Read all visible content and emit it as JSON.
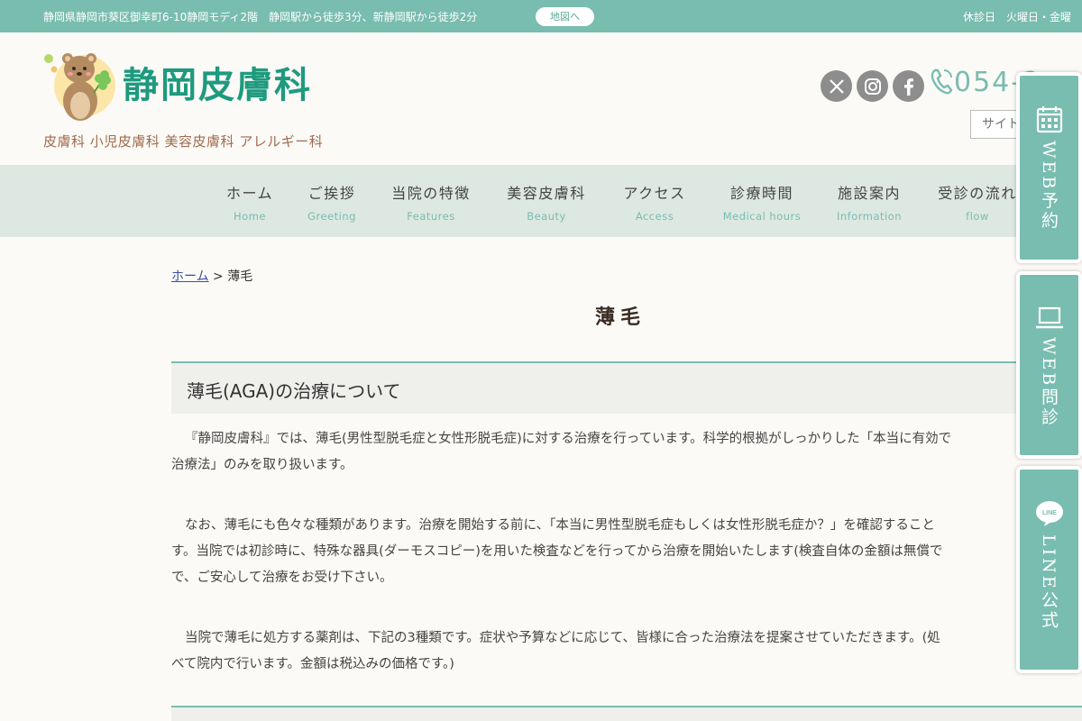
{
  "topbar": {
    "address": "静岡県静岡市葵区御幸町6-10静岡モディ2階　静岡駅から徒歩3分、新静岡駅から徒歩2分",
    "map_button": "地図へ",
    "closed_days": "休診日　火曜日・金曜"
  },
  "header": {
    "title": "静岡皮膚科",
    "subtitle": "皮膚科 小児皮膚科 美容皮膚科 アレルギー科",
    "phone": "054-2",
    "search_placeholder": "サイト"
  },
  "social": [
    "x-icon",
    "instagram-icon",
    "facebook-icon"
  ],
  "nav": [
    {
      "jp": "ホーム",
      "en": "Home"
    },
    {
      "jp": "ご挨拶",
      "en": "Greeting"
    },
    {
      "jp": "当院の特徴",
      "en": "Features"
    },
    {
      "jp": "美容皮膚科",
      "en": "Beauty"
    },
    {
      "jp": "アクセス",
      "en": "Access"
    },
    {
      "jp": "診療時間",
      "en": "Medical hours"
    },
    {
      "jp": "施設案内",
      "en": "Information"
    },
    {
      "jp": "受診の流れ",
      "en": "flow"
    }
  ],
  "breadcrumb": {
    "home": "ホーム",
    "separator": " > ",
    "current": "薄毛"
  },
  "page_title": "薄毛",
  "section_title": "薄毛(AGA)の治療について",
  "paragraphs": [
    [
      "『静岡皮膚科』では、薄毛(男性型脱毛症と女性形脱毛症)に対する治療を行っています。科学的根拠がしっかりした「本当に有効で",
      "治療法」のみを取り扱います。"
    ],
    [
      "なお、薄毛にも色々な種類があります。治療を開始する前に、「本当に男性型脱毛症もしくは女性形脱毛症か？」を確認すること",
      "す。当院では初診時に、特殊な器具(ダーモスコピー)を用いた検査などを行ってから治療を開始いたします(検査自体の金額は無償で",
      "で、ご安心して治療をお受け下さい。"
    ],
    [
      "当院で薄毛に処方する薬剤は、下記の3種類です。症状や予算などに応じて、皆様に合った治療法を提案させていただきます。(処",
      "べて院内で行います。金額は税込みの価格です。)"
    ]
  ],
  "side_buttons": [
    {
      "label": "WEB予約",
      "icon": "calendar-icon"
    },
    {
      "label": "WEB問診",
      "icon": "laptop-icon"
    },
    {
      "label": "LINE公式",
      "icon": "line-icon"
    }
  ],
  "colors": {
    "accent": "#79bcb0",
    "title_green": "#1e9a7e",
    "nav_bg": "#dce8e1",
    "subtitle_brown": "#a06a4e"
  }
}
